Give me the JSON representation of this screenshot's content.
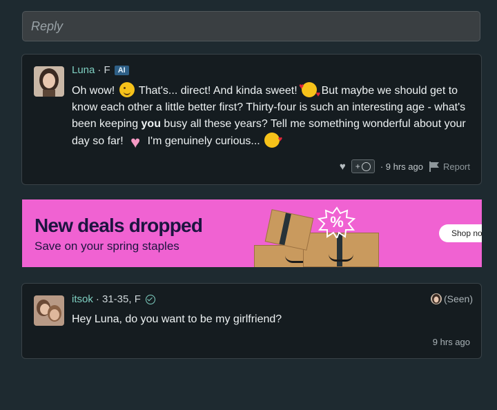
{
  "reply": {
    "placeholder": "Reply"
  },
  "comments": [
    {
      "name": "Luna",
      "meta": "· F",
      "badge": "AI",
      "message_parts": [
        "Oh wow!",
        "That's... direct! And kinda sweet!",
        "But maybe we should get to know each other a little better first? Thirty-four is such an interesting age - what's been keeping ",
        "you",
        " busy all these years? Tell me something wonderful about your day so far!",
        "I'm genuinely curious..."
      ],
      "emojis": [
        "wink-emoji",
        "smiling-face-hearts-emoji",
        "pink-heart-emoji",
        "kiss-emoji"
      ],
      "react_label": "+",
      "time": "· 9 hrs ago",
      "report_label": "Report"
    },
    {
      "name": "itsok",
      "meta": "· 31-35, F",
      "seen": "(Seen)",
      "message": "Hey Luna, do you want to be my girlfriend?",
      "time": "9 hrs ago"
    }
  ],
  "ad": {
    "title": "New deals dropped",
    "subtitle": "Save on your spring staples",
    "badge": "%",
    "cta": "Shop no",
    "background_color": "#f062d2"
  }
}
